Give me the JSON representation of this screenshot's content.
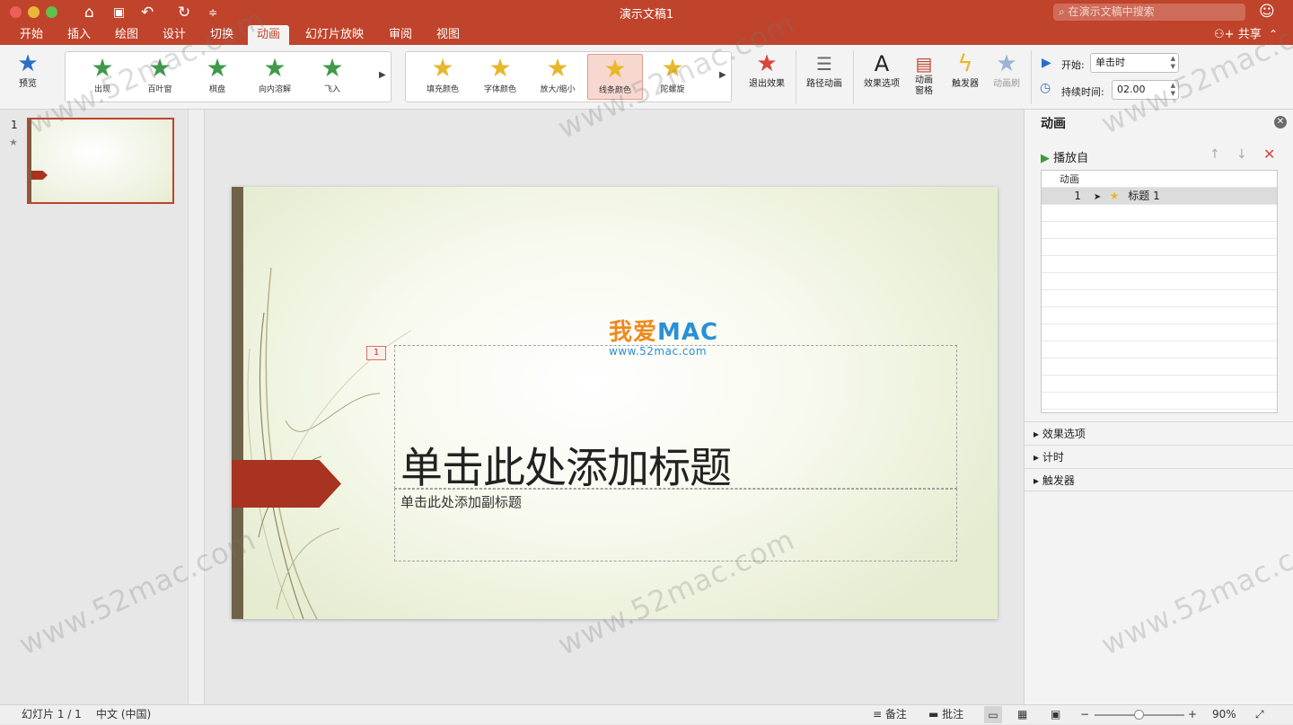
{
  "window": {
    "title": "演示文稿1",
    "search_placeholder": "在演示文稿中搜索"
  },
  "tabs": [
    "开始",
    "插入",
    "绘图",
    "设计",
    "切换",
    "动画",
    "幻灯片放映",
    "审阅",
    "视图"
  ],
  "active_tab": "动画",
  "share_label": "共享",
  "ribbon": {
    "preview_label": "预览",
    "entrance_gallery": [
      {
        "label": "出现",
        "color": "#3f9a4a"
      },
      {
        "label": "百叶窗",
        "color": "#3f9a4a"
      },
      {
        "label": "棋盘",
        "color": "#3f9a4a"
      },
      {
        "label": "向内溶解",
        "color": "#3f9a4a"
      },
      {
        "label": "飞入",
        "color": "#3f9a4a"
      }
    ],
    "emphasis_gallery": [
      {
        "label": "填充颜色",
        "color": "#e8b72a"
      },
      {
        "label": "字体颜色",
        "color": "#e8b72a"
      },
      {
        "label": "放大/缩小",
        "color": "#e8b72a"
      },
      {
        "label": "线条颜色",
        "color": "#e8b72a"
      },
      {
        "label": "陀螺旋",
        "color": "#e8b72a"
      }
    ],
    "selected_effect": "线条颜色",
    "exit_label": "退出效果",
    "path_label": "路径动画",
    "effect_options_label": "效果选项",
    "anim_pane_label": "动画\n窗格",
    "trigger_label": "触发器",
    "anim_painter_label": "动画刷",
    "start_label": "开始:",
    "start_value": "单击时",
    "duration_label": "持续时间:",
    "duration_value": "02.00"
  },
  "thumbnails": [
    {
      "number": "1"
    }
  ],
  "slide": {
    "title": "单击此处添加标题",
    "subtitle": "单击此处添加副标题",
    "anim_tag": "1",
    "logo_text_cn": "我爱",
    "logo_text_en": "MAC",
    "logo_url": "www.52mac.com"
  },
  "anim_pane": {
    "title": "动画",
    "play_label": "播放自",
    "list_header": "动画",
    "items": [
      {
        "order": "1",
        "name": "标题 1"
      }
    ],
    "sections": [
      "效果选项",
      "计时",
      "触发器"
    ]
  },
  "status": {
    "slide_info": "幻灯片 1 / 1",
    "language": "中文 (中国)",
    "notes_label": "备注",
    "comments_label": "批注",
    "zoom_value": "90%",
    "zoom_fraction": 0.5
  },
  "watermark": "www.52mac.com",
  "colors": {
    "accent": "#c0432b",
    "entrance": "#3f9a4a",
    "emphasis": "#e8b72a",
    "exit": "#d9453b"
  }
}
